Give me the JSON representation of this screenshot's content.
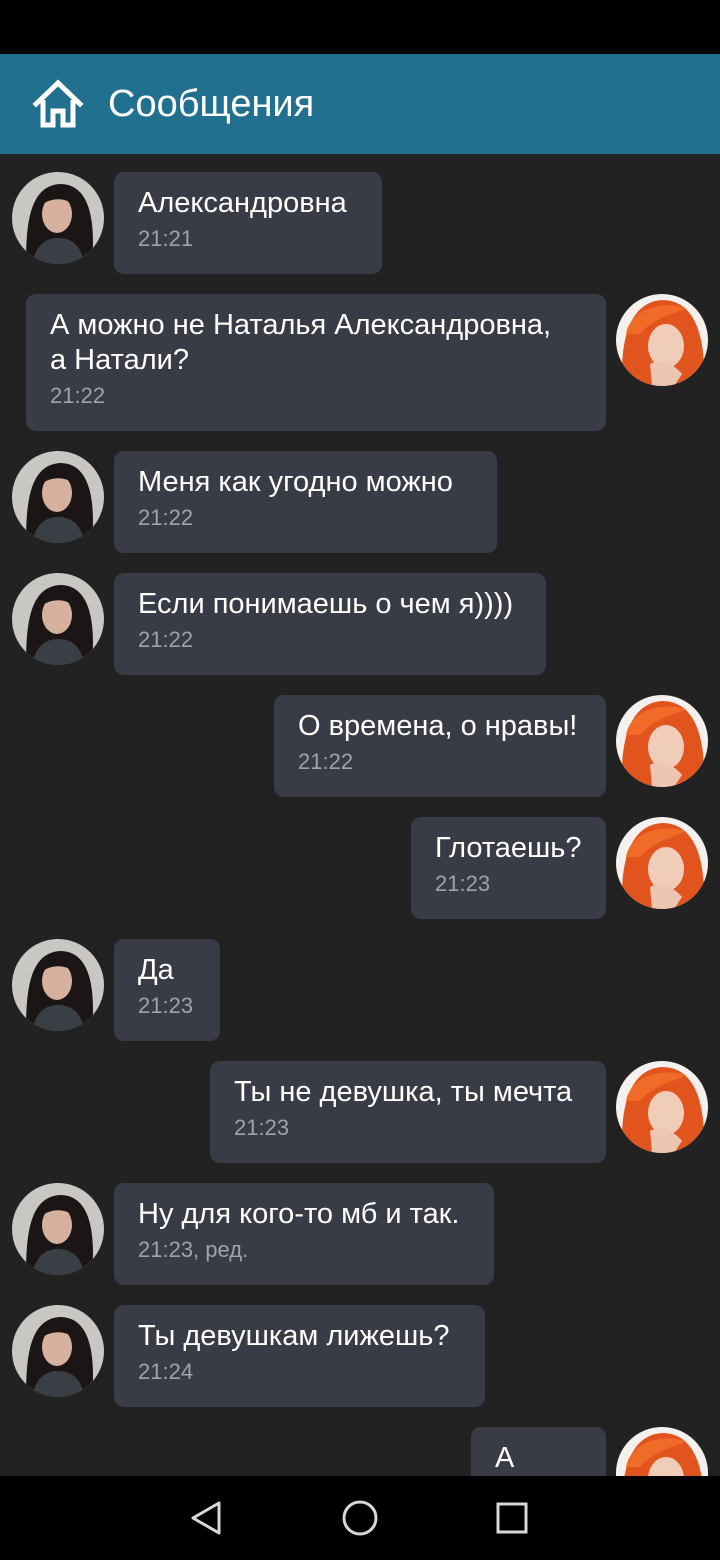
{
  "header": {
    "title": "Сообщения",
    "icon": "home-icon"
  },
  "colors": {
    "appbar": "#22708f",
    "background": "#222222",
    "bubble": "#393c46",
    "time": "#9da2ad"
  },
  "messages": [
    {
      "sender": "contact",
      "text": "Александровна",
      "time": "21:21"
    },
    {
      "sender": "me",
      "text": "А можно не Наталья Александровна,\nа Натали?",
      "time": "21:22"
    },
    {
      "sender": "contact",
      "text": "Меня как угодно можно",
      "time": "21:22"
    },
    {
      "sender": "contact",
      "text": "Если понимаешь о чем я))))",
      "time": "21:22"
    },
    {
      "sender": "me",
      "text": "О времена, о нравы!",
      "time": "21:22"
    },
    {
      "sender": "me",
      "text": "Глотаешь?",
      "time": "21:23"
    },
    {
      "sender": "contact",
      "text": "Да",
      "time": "21:23"
    },
    {
      "sender": "me",
      "text": "Ты не девушка, ты мечта",
      "time": "21:23"
    },
    {
      "sender": "contact",
      "text": "Ну для кого-то мб и так.",
      "time": "21:23, ред."
    },
    {
      "sender": "contact",
      "text": "Ты девушкам лижешь?",
      "time": "21:24"
    },
    {
      "sender": "me",
      "text": "А что?",
      "time": ""
    }
  ],
  "navbar": {
    "back": "back-icon",
    "home": "home-circle-icon",
    "recents": "recents-icon"
  }
}
